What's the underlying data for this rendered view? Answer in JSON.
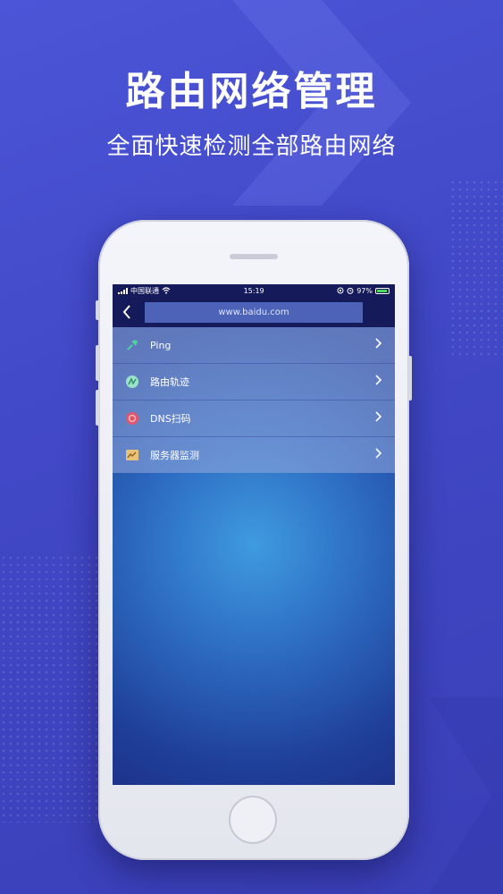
{
  "headline": "路由网络管理",
  "subline": "全面快速检测全部路由网络",
  "status_bar": {
    "carrier": "中国联通",
    "time": "15:19",
    "battery": "97%"
  },
  "nav": {
    "url": "www.baidu.com"
  },
  "menu": [
    {
      "label": "Ping",
      "icon": "pin-icon"
    },
    {
      "label": "路由轨迹",
      "icon": "route-icon"
    },
    {
      "label": "DNS扫码",
      "icon": "dns-icon"
    },
    {
      "label": "服务器监测",
      "icon": "monitor-icon"
    }
  ],
  "colors": {
    "background": "#4249c8",
    "nav_bar": "#151a5a",
    "url_box": "#4d63b8"
  }
}
